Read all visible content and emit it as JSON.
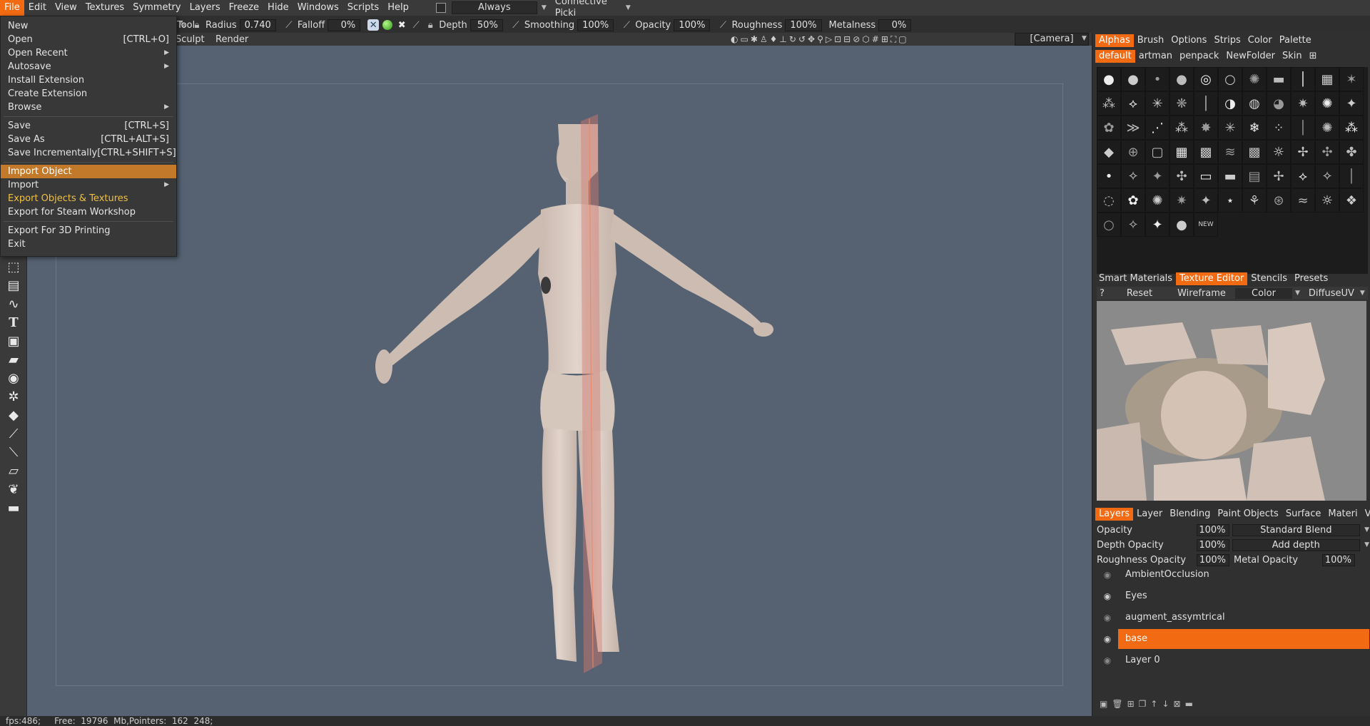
{
  "menubar": {
    "items": [
      "File",
      "Edit",
      "View",
      "Textures",
      "Symmetry",
      "Layers",
      "Freeze",
      "Hide",
      "Windows",
      "Scripts",
      "Help"
    ],
    "always_label": "Always",
    "picking_label": "Connective Picki"
  },
  "toolbar": {
    "radius_label": "Radius",
    "radius_value": "0.740",
    "falloff_label": "Falloff",
    "falloff_value": "0%",
    "depth_label": "Depth",
    "depth_value": "50%",
    "smoothing_label": "Smoothing",
    "smoothing_value": "100%",
    "opacity_label": "Opacity",
    "opacity_value": "100%",
    "roughness_label": "Roughness",
    "roughness_value": "100%",
    "metalness_label": "Metalness",
    "metalness_value": "0%"
  },
  "room_tabs": {
    "tool": "Tool",
    "sculpt": "Sculpt",
    "render": "Render"
  },
  "camera_label": "[Camera]",
  "file_menu": {
    "new": "New",
    "open": "Open",
    "open_sc": "[CTRL+O]",
    "open_recent": "Open Recent",
    "autosave": "Autosave",
    "install_ext": "Install Extension",
    "create_ext": "Create Extension",
    "browse": "Browse",
    "save": "Save",
    "save_sc": "[CTRL+S]",
    "save_as": "Save As",
    "save_as_sc": "[CTRL+ALT+S]",
    "save_inc": "Save Incrementally",
    "save_inc_sc": "[CTRL+SHIFT+S]",
    "import_object": "Import Object",
    "import": "Import",
    "export_objects": "Export Objects & Textures",
    "export_steam": "Export for Steam Workshop",
    "export_3d": "Export For 3D Printing",
    "exit": "Exit"
  },
  "right_panel": {
    "top_tabs": [
      "Alphas",
      "Brush",
      "Options",
      "Strips",
      "Color",
      "Palette"
    ],
    "preset_tabs": [
      "default",
      "artman",
      "penpack",
      "NewFolder",
      "Skin"
    ],
    "new_label": "NEW",
    "mid_tabs": [
      "Smart Materials",
      "Texture Editor",
      "Stencils",
      "Presets"
    ],
    "tex_q": "?",
    "tex_reset": "Reset",
    "tex_wireframe": "Wireframe",
    "tex_color": "Color",
    "tex_uv": "DiffuseUV",
    "layer_tabs": [
      "Layers",
      "Layer",
      "Blending",
      "Paint Objects",
      "Surface",
      "Materi",
      "VoxTree"
    ],
    "opacity_label": "Opacity",
    "opacity_value": "100%",
    "blend_mode": "Standard Blend",
    "depth_opacity_label": "Depth Opacity",
    "depth_opacity_value": "100%",
    "depth_mode": "Add depth",
    "rough_opacity_label": "Roughness Opacity",
    "rough_opacity_value": "100%",
    "metal_opacity_label": "Metal Opacity",
    "metal_opacity_value": "100%",
    "layers": [
      "AmbientOcclusion",
      "Eyes",
      "augment_assymtrical",
      "base",
      "Layer 0"
    ],
    "selected_layer": "base"
  },
  "status": {
    "text": "fps:486;     Free:  19796  Mb,Pointers:  162  248;"
  },
  "colors": {
    "accent": "#f26b12",
    "highlight": "#c27a2a",
    "viewport": "#566272"
  }
}
